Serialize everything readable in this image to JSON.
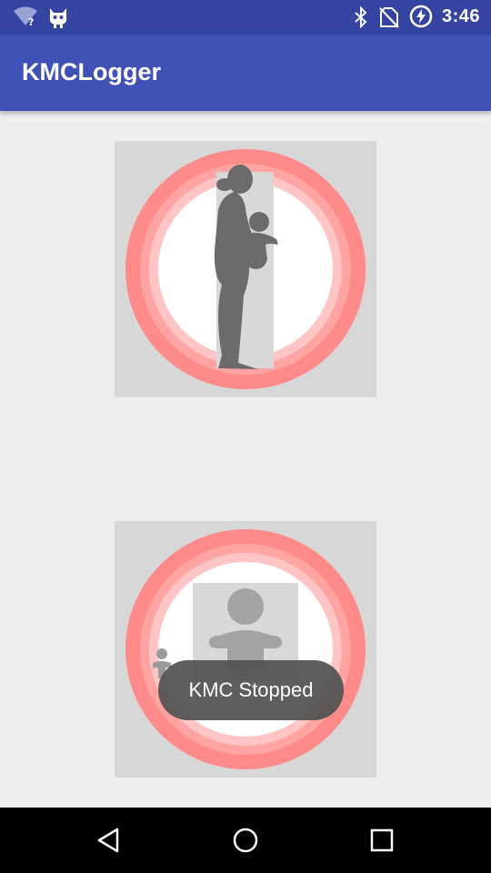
{
  "status_bar": {
    "time": "3:46",
    "icons": [
      "wifi-unknown-icon",
      "cat-icon",
      "bluetooth-icon",
      "no-sim-icon",
      "battery-charging-icon"
    ]
  },
  "app_bar": {
    "title": "KMCLogger"
  },
  "buttons": [
    {
      "icon": "mother-holding-baby-icon",
      "ring_colors": [
        "#ff8a8a",
        "#ffa3a3",
        "#ffc4c4",
        "#ffffff"
      ]
    },
    {
      "icon": "baby-icon",
      "ring_colors": [
        "#ff8a8a",
        "#ffa3a3",
        "#ffc4c4",
        "#ffffff"
      ]
    }
  ],
  "toast": {
    "text": "KMC Stopped"
  },
  "nav_bar": {
    "icons": [
      "back-icon",
      "home-icon",
      "recents-icon"
    ]
  },
  "colors": {
    "status_bar": "#3444a0",
    "app_bar": "#3f51b5",
    "background": "#eeeeee",
    "button_bg": "#d7d7d7",
    "silhouette": "#6b6b6b"
  }
}
